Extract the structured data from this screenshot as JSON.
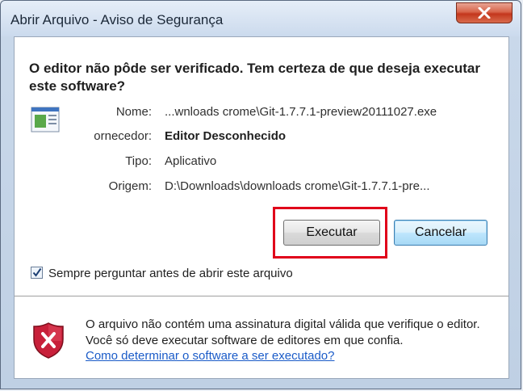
{
  "window": {
    "title": "Abrir Arquivo - Aviso de Segurança"
  },
  "dialog": {
    "question": "O editor não pôde ser verificado. Tem certeza de que deseja executar este software?",
    "fields": [
      {
        "label": "Nome:",
        "value": "...wnloads crome\\Git-1.7.7.1-preview20111027.exe",
        "bold": false
      },
      {
        "label": "ornecedor:",
        "value": "Editor Desconhecido",
        "bold": true
      },
      {
        "label": "Tipo:",
        "value": "Aplicativo",
        "bold": false
      },
      {
        "label": "Origem:",
        "value": "D:\\Downloads\\downloads crome\\Git-1.7.7.1-pre...",
        "bold": false
      }
    ],
    "buttons": {
      "run": "Executar",
      "cancel": "Cancelar"
    },
    "checkbox": {
      "label": "Sempre perguntar antes de abrir este arquivo",
      "checked": true
    },
    "warning": {
      "text": "O arquivo não contém uma assinatura digital válida que verifique o editor. Você só deve executar software de editores em que confia.",
      "link": "Como determinar o software a ser executado?"
    }
  },
  "colors": {
    "highlight": "#e0001a",
    "link": "#1a5bc8"
  },
  "icons": [
    "close-icon",
    "application-icon",
    "checkmark-icon",
    "security-shield-icon"
  ]
}
